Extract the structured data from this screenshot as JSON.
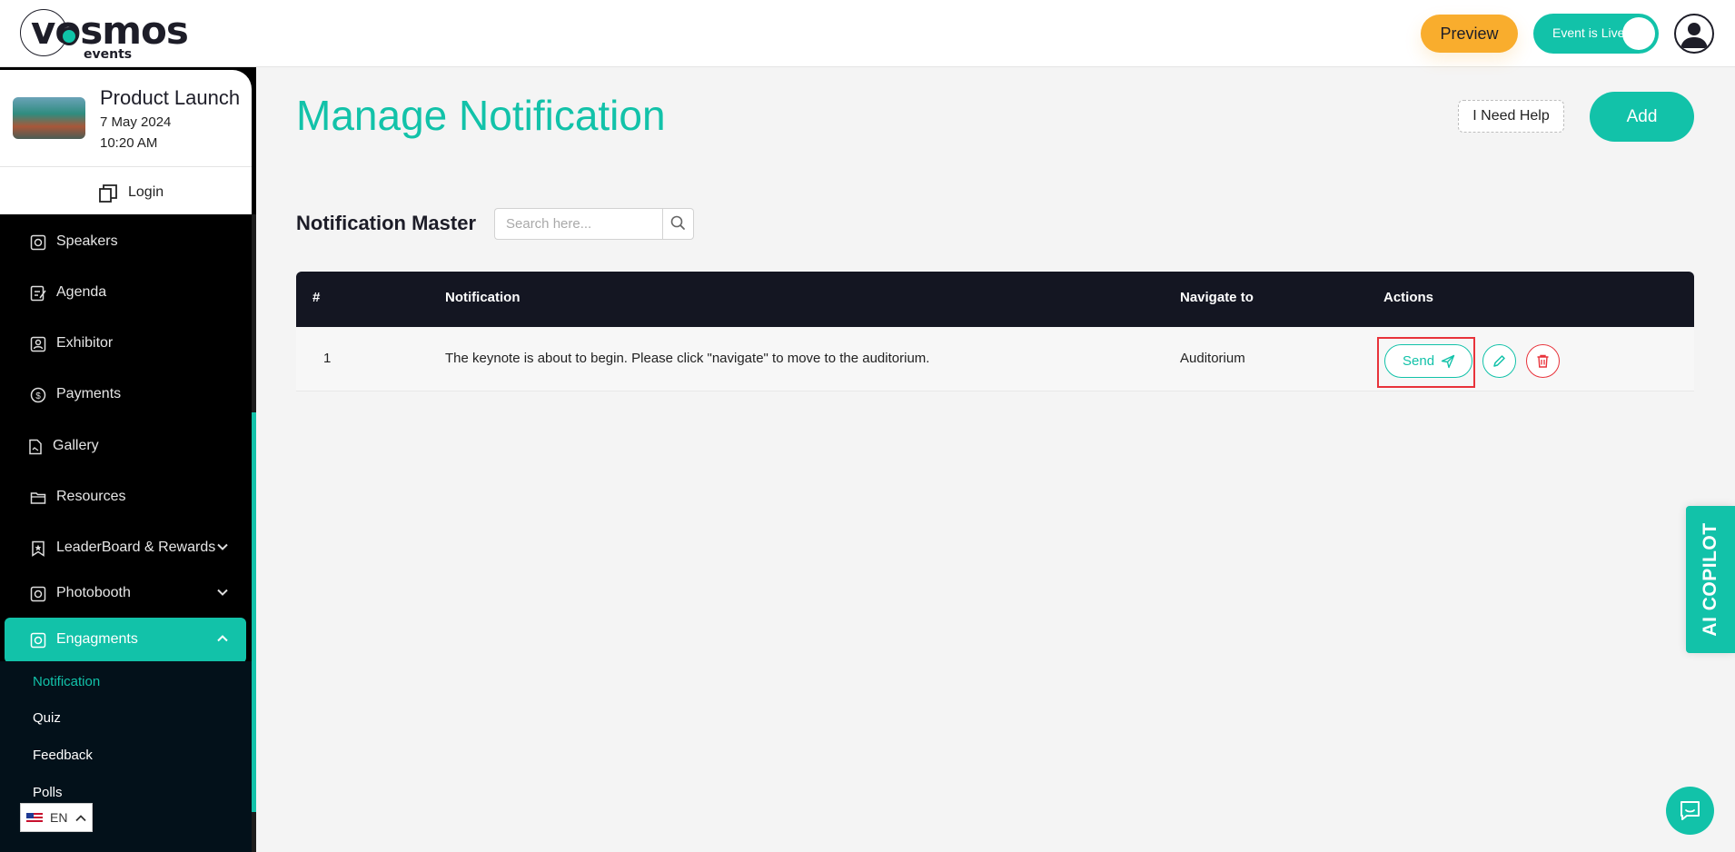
{
  "brand": {
    "logo_text": "vosmos",
    "logo_subtext": "events"
  },
  "header": {
    "preview_label": "Preview",
    "live_label": "Event is Live",
    "live_on": true,
    "accent_color": "#12c2a9",
    "preview_color": "#f9ad2d"
  },
  "event": {
    "title": "Product Launch",
    "date": "7 May 2024",
    "time": "10:20 AM",
    "login_label": "Login"
  },
  "sidebar": {
    "items": [
      {
        "label": "Speakers",
        "icon": "speakers-icon"
      },
      {
        "label": "Agenda",
        "icon": "agenda-icon"
      },
      {
        "label": "Exhibitor",
        "icon": "exhibitor-icon"
      },
      {
        "label": "Payments",
        "icon": "payments-icon"
      },
      {
        "label": "Gallery",
        "icon": "gallery-icon"
      },
      {
        "label": "Resources",
        "icon": "folder-icon"
      },
      {
        "label": "LeaderBoard & Rewards",
        "icon": "bookmark-star-icon",
        "expandable": true
      },
      {
        "label": "Photobooth",
        "icon": "camera-icon",
        "expandable": true
      },
      {
        "label": "Engagments",
        "icon": "engagement-icon",
        "expandable": true,
        "expanded": true,
        "active": true
      }
    ],
    "subitems": [
      {
        "label": "Notification",
        "active": true
      },
      {
        "label": "Quiz"
      },
      {
        "label": "Feedback"
      },
      {
        "label": "Polls"
      }
    ],
    "language": "EN"
  },
  "main": {
    "title": "Manage Notification",
    "help_label": "I Need Help",
    "add_label": "Add",
    "section_title": "Notification Master",
    "search_placeholder": "Search here..."
  },
  "table": {
    "headers": [
      "#",
      "Notification",
      "Navigate to",
      "Actions"
    ],
    "rows": [
      {
        "index": "1",
        "notification": "The keynote is about to begin. Please click \"navigate\" to move to the auditorium.",
        "navigate_to": "Auditorium",
        "send_label": "Send"
      }
    ]
  },
  "copilot_label": "AI COPILOT"
}
